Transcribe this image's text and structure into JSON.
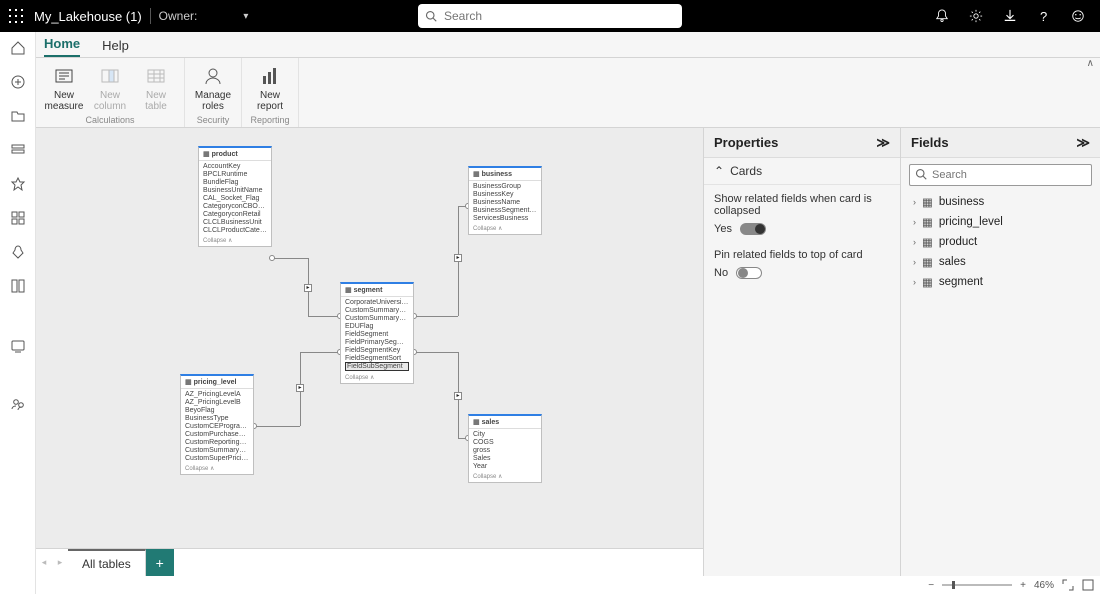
{
  "topbar": {
    "title": "My_Lakehouse (1)",
    "owner_label": "Owner:",
    "search_placeholder": "Search"
  },
  "tabs": {
    "home": "Home",
    "help": "Help"
  },
  "ribbon": {
    "new_measure": "New measure",
    "new_column": "New column",
    "new_table": "New table",
    "manage_roles": "Manage roles",
    "new_report": "New report",
    "group_calc": "Calculations",
    "group_sec": "Security",
    "group_rep": "Reporting"
  },
  "cards": {
    "product": {
      "name": "product",
      "fields": [
        "AccountKey",
        "BPCLRuntime",
        "BundleFlag",
        "BusinessUnitName",
        "CAL_Socket_Flag",
        "CategoryconCBOFileId",
        "CategoryconRetail",
        "CLCLBusinessUnit",
        "CLCLProductCatecolmodinServices"
      ],
      "foot": "Collapse ∧"
    },
    "business": {
      "name": "business",
      "fields": [
        "BusinessGroup",
        "BusinessKey",
        "BusinessName",
        "BusinessSegmentName",
        "ServicesBusiness"
      ],
      "foot": "Collapse ∧"
    },
    "segment": {
      "name": "segment",
      "fields": [
        "CorporateUniversityFlag",
        "CustomSummarySector",
        "CustomSummarySegment",
        "EDUFlag",
        "FieldSegment",
        "FieldPrimarySegment",
        "FieldSegmentKey",
        "FieldSegmentSort",
        "FieldSubSegment"
      ],
      "foot": "Collapse ∧"
    },
    "pricing_level": {
      "name": "pricing_level",
      "fields": [
        "AZ_PricingLevelA",
        "AZ_PricingLevelB",
        "BeyoFlag",
        "BusinessType",
        "CustomCEProgramType",
        "CustomPurchaseType",
        "CustomReportingSummaryPuFo",
        "CustomSummaryPurchaseType",
        "CustomSuperPricingLevel"
      ],
      "foot": "Collapse ∧"
    },
    "sales": {
      "name": "sales",
      "fields": [
        "City",
        "COGS",
        "gross",
        "Sales",
        "Year"
      ],
      "foot": "Collapse ∧"
    }
  },
  "bottom": {
    "all_tables": "All tables"
  },
  "properties": {
    "title": "Properties",
    "cards_section": "Cards",
    "opt1": "Show related fields when card is collapsed",
    "opt1_state": "Yes",
    "opt2": "Pin related fields to top of card",
    "opt2_state": "No"
  },
  "fields": {
    "title": "Fields",
    "search_placeholder": "Search",
    "tables": [
      "business",
      "pricing_level",
      "product",
      "sales",
      "segment"
    ]
  },
  "status": {
    "zoom": "46%"
  }
}
